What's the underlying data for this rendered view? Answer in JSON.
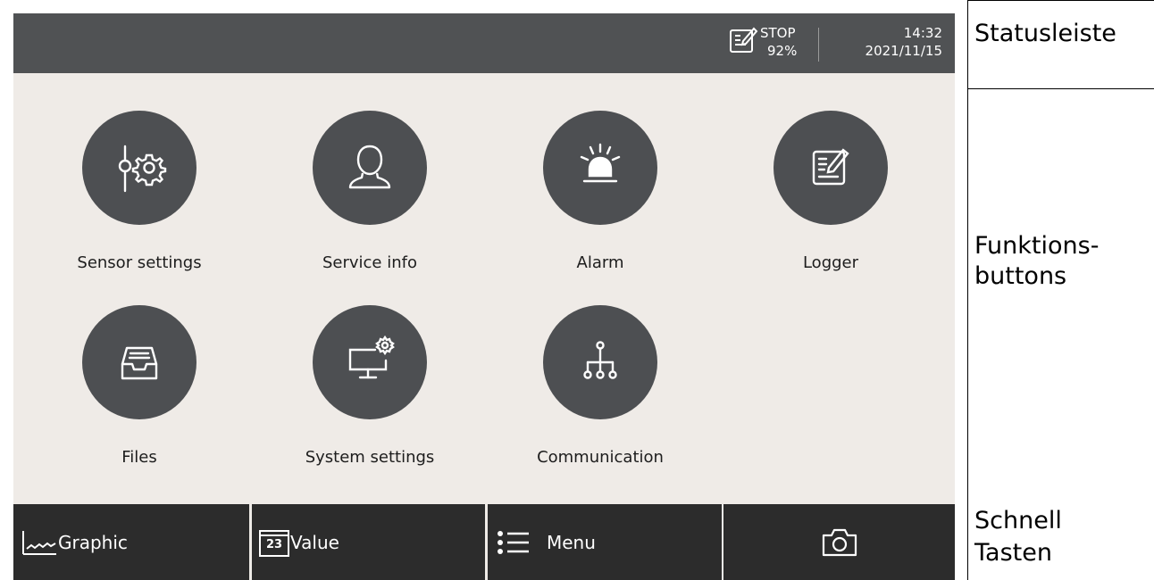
{
  "status_bar": {
    "state": "STOP",
    "level": "92%",
    "time": "14:32",
    "date": "2021/11/15",
    "icon": "logger-icon"
  },
  "function_buttons": [
    {
      "label": "Sensor settings",
      "icon": "sensor-settings-icon"
    },
    {
      "label": "Service info",
      "icon": "person-icon"
    },
    {
      "label": "Alarm",
      "icon": "alarm-siren-icon"
    },
    {
      "label": "Logger",
      "icon": "logger-icon"
    },
    {
      "label": "Files",
      "icon": "inbox-tray-icon"
    },
    {
      "label": "System settings",
      "icon": "monitor-gear-icon"
    },
    {
      "label": "Communication",
      "icon": "network-tree-icon"
    }
  ],
  "quick_keys": [
    {
      "label": "Graphic",
      "icon": "graph-icon"
    },
    {
      "label": "Value",
      "icon": "calendar-value-icon",
      "badge": "23"
    },
    {
      "label": "Menu",
      "icon": "menu-list-icon"
    },
    {
      "label": "",
      "icon": "camera-icon"
    }
  ],
  "legend": {
    "status": "Statusleiste",
    "buttons_line1": "Funktions-",
    "buttons_line2": "buttons",
    "quick_line1": "Schnell",
    "quick_line2": "Tasten"
  },
  "colors": {
    "status_bar_bg": "#505254",
    "screen_bg": "#efebe7",
    "icon_circle": "#4d4f52",
    "quick_key_bg": "#2c2c2c"
  }
}
